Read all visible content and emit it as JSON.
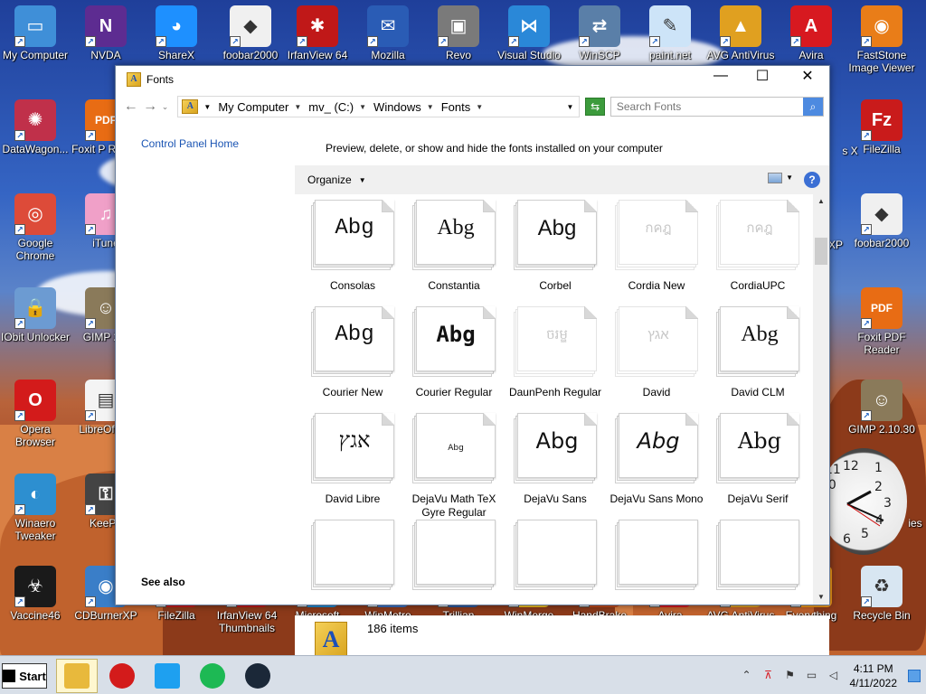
{
  "desktop": {
    "icons": [
      {
        "label": "My Computer",
        "color": "#3f8fd8",
        "glyph": "▭"
      },
      {
        "label": "NVDA",
        "color": "#5d2c91",
        "glyph": "N"
      },
      {
        "label": "ShareX",
        "color": "#1e90ff",
        "glyph": "◕"
      },
      {
        "label": "foobar2000",
        "color": "#f0f0f0",
        "glyph": "◆"
      },
      {
        "label": "IrfanView 64",
        "color": "#c01818",
        "glyph": "✱"
      },
      {
        "label": "Mozilla",
        "color": "#2a5cb5",
        "glyph": "✉"
      },
      {
        "label": "Revo",
        "color": "#7a7a7a",
        "glyph": "▣"
      },
      {
        "label": "Visual Studio",
        "color": "#2a88d8",
        "glyph": "⋈"
      },
      {
        "label": "WinSCP",
        "color": "#5a7fa8",
        "glyph": "⇄"
      },
      {
        "label": "paint.net",
        "color": "#cde4f8",
        "glyph": "✎"
      },
      {
        "label": "AVG AntiVirus",
        "color": "#e0a020",
        "glyph": "▲"
      },
      {
        "label": "Avira",
        "color": "#d71920",
        "glyph": "A"
      },
      {
        "label": "FastStone Image Viewer",
        "color": "#e97d18",
        "glyph": "◉"
      },
      {
        "label": "DataWagon...",
        "color": "#c0304a",
        "glyph": "✺"
      },
      {
        "label": "Foxit P Reade",
        "color": "#e86c14",
        "glyph": "PDF"
      },
      {
        "label": "FileZilla",
        "color": "#c91b1b",
        "glyph": "Fz"
      },
      {
        "label": "Google Chrome",
        "color": "#dd4b39",
        "glyph": "◎"
      },
      {
        "label": "iTune",
        "color": "#f0a0c8",
        "glyph": "♫"
      },
      {
        "label": "foobar2000",
        "color": "#f0f0f0",
        "glyph": "◆"
      },
      {
        "label": "IObit Unlocker",
        "color": "#6c9bd2",
        "glyph": "🔒"
      },
      {
        "label": "GIMP 2.1",
        "color": "#8a7a5a",
        "glyph": "☺"
      },
      {
        "label": "Foxit PDF Reader",
        "color": "#e86c14",
        "glyph": "PDF"
      },
      {
        "label": "Opera Browser",
        "color": "#d31b1b",
        "glyph": "O"
      },
      {
        "label": "LibreOf 7.3",
        "color": "#f4f4f4",
        "glyph": "▤"
      },
      {
        "label": "GIMP 2.10.30",
        "color": "#8a7a5a",
        "glyph": "☺"
      },
      {
        "label": "Winaero Tweaker",
        "color": "#2d8fd0",
        "glyph": "◐"
      },
      {
        "label": "KeePa",
        "color": "#444",
        "glyph": "⚿"
      },
      {
        "label": "Vaccine46",
        "color": "#1a1a1a",
        "glyph": "☣"
      },
      {
        "label": "CDBurnerXP",
        "color": "#3a7ec8",
        "glyph": "◉"
      },
      {
        "label": "FileZilla",
        "color": "#c91b1b",
        "glyph": "Fz"
      },
      {
        "label": "IrfanView 64 Thumbnails",
        "color": "#c01818",
        "glyph": "✱"
      },
      {
        "label": "Microsoft Edge",
        "color": "#1f8ad2",
        "glyph": "e"
      },
      {
        "label": "WinMetro",
        "color": "#3a6fc0",
        "glyph": "▦"
      },
      {
        "label": "Trillian",
        "color": "#2c5aa0",
        "glyph": "T"
      },
      {
        "label": "WinMerge",
        "color": "#f0c020",
        "glyph": "≡"
      },
      {
        "label": "HandBrake",
        "color": "#c34a1a",
        "glyph": "☕"
      },
      {
        "label": "Avira",
        "color": "#d71920",
        "glyph": "A"
      },
      {
        "label": "AVG AntiVirus FREE",
        "color": "#e0a020",
        "glyph": "▲"
      },
      {
        "label": "Everything",
        "color": "#f39b18",
        "glyph": "⌕"
      },
      {
        "label": "Recycle Bin",
        "color": "#d8e6f2",
        "glyph": "♻"
      }
    ],
    "partial_labels": {
      "s_x": "s X",
      "xp": "XP",
      "ies": "ies"
    }
  },
  "window": {
    "title": "Fonts",
    "minimize_label": "—",
    "maximize_label": "☐",
    "close_label": "✕",
    "breadcrumb": [
      "My Computer",
      "mv_ (C:)",
      "Windows",
      "Fonts"
    ],
    "search_placeholder": "Search Fonts",
    "left_pane": {
      "control_panel_home": "Control Panel Home",
      "see_also": "See also"
    },
    "header_text": "Preview, delete, or show and hide the fonts installed on your computer",
    "toolbar": {
      "organize_label": "Organize"
    },
    "fonts": [
      {
        "name": "Consolas",
        "sample": "Abg",
        "faded": false,
        "font": "mono"
      },
      {
        "name": "Constantia",
        "sample": "Abg",
        "faded": false,
        "font": "serif"
      },
      {
        "name": "Corbel",
        "sample": "Abg",
        "faded": false,
        "font": "sans"
      },
      {
        "name": "Cordia New",
        "sample": "กคฎ",
        "faded": true,
        "font": "sans"
      },
      {
        "name": "CordiaUPC",
        "sample": "กคฎ",
        "faded": true,
        "font": "sans"
      },
      {
        "name": "Courier New",
        "sample": "Abg",
        "faded": false,
        "font": "courier"
      },
      {
        "name": "Courier Regular",
        "sample": "Abg",
        "faded": false,
        "font": "couriermono"
      },
      {
        "name": "DaunPenh Regular",
        "sample": "ចរម្ឌ",
        "faded": true,
        "font": "sans"
      },
      {
        "name": "David",
        "sample": "אגץ",
        "faded": true,
        "font": "sans"
      },
      {
        "name": "David CLM",
        "sample": "Abg",
        "faded": false,
        "font": "serif"
      },
      {
        "name": "David Libre",
        "sample": "אגץ",
        "faded": false,
        "font": "serif"
      },
      {
        "name": "DejaVu Math TeX Gyre Regular",
        "sample": "Abg",
        "faded": false,
        "font": "tiny"
      },
      {
        "name": "DejaVu Sans",
        "sample": "Abg",
        "faded": false,
        "font": "dejavu"
      },
      {
        "name": "DejaVu Sans Mono",
        "sample": "Abg",
        "faded": false,
        "font": "dejavuitalic"
      },
      {
        "name": "DejaVu Serif",
        "sample": "Abg",
        "faded": false,
        "font": "dejavuserif"
      }
    ],
    "item_count": "186 items"
  },
  "clock": {
    "numbers": [
      "12",
      "1",
      "2",
      "3",
      "4",
      "5",
      "6",
      "9",
      "10",
      "11"
    ]
  },
  "taskbar": {
    "start_label": "Start",
    "pinned": [
      {
        "name": "file-explorer",
        "color": "#e8b93c",
        "active": true
      },
      {
        "name": "opera",
        "color": "#d31b1b",
        "active": false
      },
      {
        "name": "windows",
        "color": "#1ea0f0",
        "active": false
      },
      {
        "name": "spotify",
        "color": "#1db954",
        "active": false
      },
      {
        "name": "steam",
        "color": "#1b2838",
        "active": false
      }
    ],
    "time": "4:11 PM",
    "date": "4/11/2022"
  }
}
